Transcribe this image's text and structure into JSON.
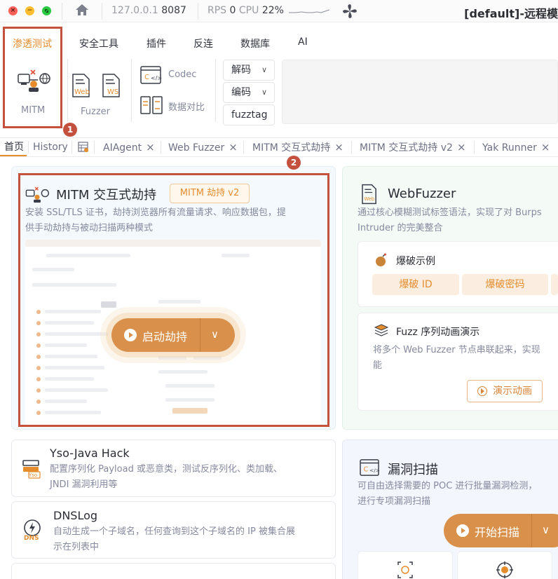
{
  "titlebar": {
    "host": "127.0.0.1",
    "port": "8087",
    "rps_label": "RPS",
    "rps_value": "0",
    "cpu_label": "CPU",
    "cpu_value": "22%",
    "title": "[default]-远程模"
  },
  "menu": {
    "items": [
      {
        "label": "渗透测试",
        "active": true
      },
      {
        "label": "安全工具"
      },
      {
        "label": "插件"
      },
      {
        "label": "反连"
      },
      {
        "label": "数据库"
      },
      {
        "label": "AI"
      }
    ]
  },
  "tools": {
    "mitm_label": "MITM",
    "web_badge": "Web",
    "ws_badge": "WS",
    "fuzzer_label": "Fuzzer",
    "codec_label": "Codec",
    "compare_label": "数据对比",
    "decode_label": "解码",
    "encode_label": "编码",
    "fuzztag_label": "fuzztag"
  },
  "annotations": {
    "badge1": "1",
    "badge2": "2"
  },
  "tabs": [
    {
      "label": "首页"
    },
    {
      "label": "History"
    },
    {
      "label": "AIAgent"
    },
    {
      "label": "Web Fuzzer"
    },
    {
      "label": "MITM 交互式劫持"
    },
    {
      "label": "MITM 交互式劫持 v2"
    },
    {
      "label": "Yak Runner"
    }
  ],
  "mitm_card": {
    "title": "MITM 交互式劫持",
    "badge": "MITM 劫持 v2",
    "desc_line1": "安装 SSL/TLS 证书，劫持浏览器所有流量请求、响应数据包，提",
    "desc_line2": "供手动劫持与被动扫描两种模式",
    "start_button": "启动劫持"
  },
  "fuzzer_card": {
    "title": "WebFuzzer",
    "desc_line1": "通过核心模糊测试标签语法，实现了对 Burps",
    "desc_line2": "Intruder 的完美整合",
    "brute_title": "爆破示例",
    "pill1": "爆破 ID",
    "pill2": "爆破密码",
    "seq_title": "Fuzz 序列动画演示",
    "seq_desc_line1": "将多个 Web Fuzzer 节点串联起来，实现",
    "seq_desc_line2": "能",
    "demo_button": "演示动画"
  },
  "yso_card": {
    "title": "Yso-Java Hack",
    "desc_line1": "配置序列化 Payload 或恶意类，测试反序列化、类加载、",
    "desc_line2": "JNDI 漏洞利用等",
    "icon_badge": "Yso"
  },
  "dnslog_card": {
    "title": "DNSLog",
    "desc_line1": "自动生成一个子域名，任何查询到这个子域名的 IP 被集合展",
    "desc_line2": "示在列表中",
    "icon_badge": "DNS"
  },
  "scan_card": {
    "title": "漏洞扫描",
    "desc_line1": "可自由选择需要的 POC 进行批量漏洞检测，",
    "desc_line2": "进行专项漏洞扫描",
    "scan_button": "开始扫描"
  },
  "colors": {
    "accent": "#e58c2d",
    "highlight": "#c4513e",
    "button": "#d9904a"
  }
}
